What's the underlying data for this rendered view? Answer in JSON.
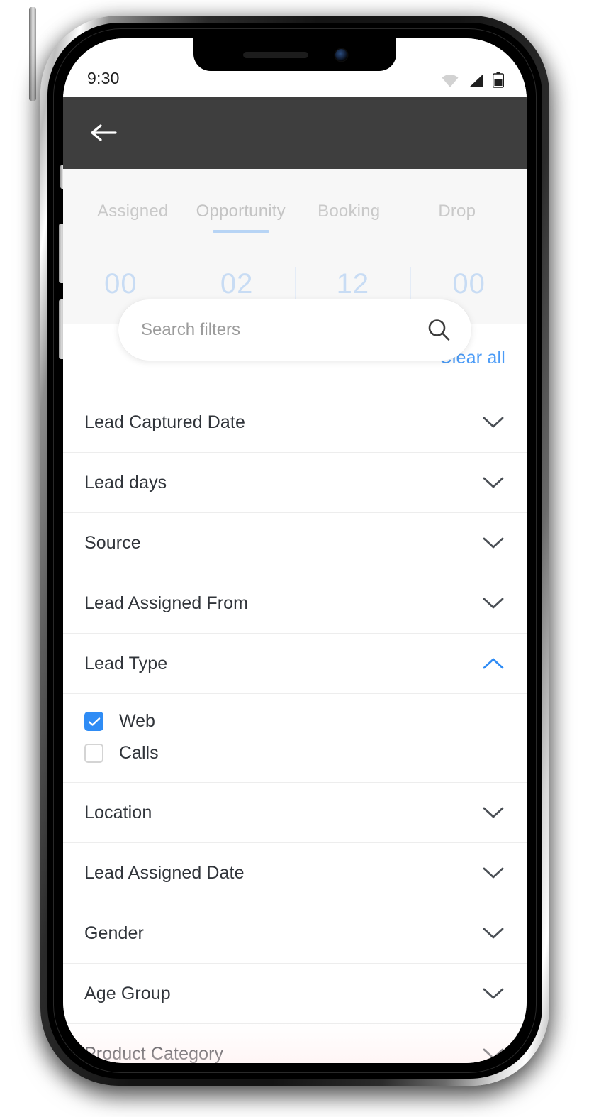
{
  "status_bar": {
    "time": "9:30",
    "icons": [
      "wifi-icon",
      "signal-icon",
      "battery-icon"
    ]
  },
  "toolbar": {
    "back_icon": "back-arrow-icon",
    "background_color": "#3e3e3e"
  },
  "tabs": [
    {
      "label": "Assigned",
      "active": false
    },
    {
      "label": "Opportunity",
      "active": true
    },
    {
      "label": "Booking",
      "active": false
    },
    {
      "label": "Drop",
      "active": false
    }
  ],
  "counters": [
    "00",
    "02",
    "12",
    "00"
  ],
  "search": {
    "placeholder": "Search filters",
    "value": "",
    "icon": "search-icon"
  },
  "filter_panel": {
    "clear_all_label": "Clear all",
    "accent_color": "#4a9bf7",
    "rows": [
      {
        "label": "Lead Captured Date",
        "expanded": false
      },
      {
        "label": "Lead days",
        "expanded": false
      },
      {
        "label": "Source",
        "expanded": false
      },
      {
        "label": "Lead Assigned From",
        "expanded": false
      },
      {
        "label": "Lead Type",
        "expanded": true
      },
      {
        "label": "Location",
        "expanded": false
      },
      {
        "label": "Lead Assigned Date",
        "expanded": false
      },
      {
        "label": "Gender",
        "expanded": false
      },
      {
        "label": "Age Group",
        "expanded": false
      },
      {
        "label": "Product Category",
        "expanded": false
      }
    ],
    "lead_type_options": [
      {
        "label": "Web",
        "checked": true
      },
      {
        "label": "Calls",
        "checked": false
      }
    ]
  },
  "colors": {
    "accent_blue": "#2f8cf5",
    "link_blue": "#4a9bf7",
    "toolbar_gray": "#3e3e3e",
    "text_primary": "#30343a",
    "counter_blue": "#c8dcf4"
  }
}
